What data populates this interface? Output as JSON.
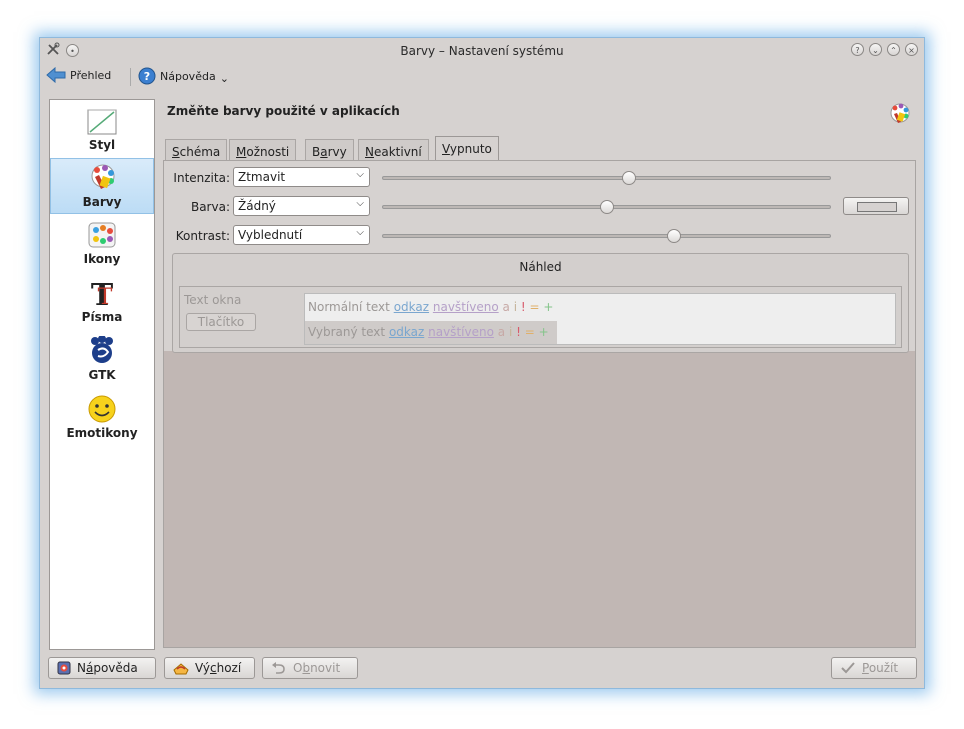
{
  "window": {
    "title": "Barvy – Nastavení systému"
  },
  "toolbar": {
    "back_label": "Přehled",
    "help_label": "Nápověda",
    "help_arrow": "⌄"
  },
  "sidebar": {
    "items": [
      {
        "label": "Styl",
        "icon": "style-icon"
      },
      {
        "label": "Barvy",
        "icon": "colors-icon"
      },
      {
        "label": "Ikony",
        "icon": "icons-icon"
      },
      {
        "label": "Písma",
        "icon": "fonts-icon"
      },
      {
        "label": "GTK",
        "icon": "gtk-icon"
      },
      {
        "label": "Emotikony",
        "icon": "emoticons-icon"
      }
    ],
    "active_index": 1
  },
  "main": {
    "heading": "Změňte barvy použité v aplikacích",
    "tabs": [
      {
        "label": "Schéma",
        "u": "S",
        "rest": "chéma"
      },
      {
        "label": "Možnosti",
        "u": "M",
        "rest": "ožnosti"
      },
      {
        "label": "Barvy",
        "pre": "B",
        "u": "a",
        "rest": "rvy"
      },
      {
        "label": "Neaktivní",
        "u": "N",
        "rest": "eaktivní"
      },
      {
        "label": "Vypnuto",
        "u": "V",
        "rest": "ypnuto"
      }
    ],
    "active_tab": 4,
    "rows": {
      "intensity": {
        "label": "Intenzita:",
        "value": "Ztmavit",
        "slider": 0.55
      },
      "color": {
        "label": "Barva:",
        "value": "Žádný",
        "slider": 0.5
      },
      "contrast": {
        "label": "Kontrast:",
        "value": "Vyblednutí",
        "slider": 0.65
      }
    },
    "preview": {
      "title": "Náhled",
      "window_text": "Text okna",
      "button": "Tlačítko",
      "normal_text": "Normální text",
      "selected_text": "Vybraný text",
      "link": "odkaz",
      "visited": "navštíveno",
      "a": "a",
      "i": "i",
      "excl": "!",
      "eq": "=",
      "plus": "+"
    }
  },
  "buttons": {
    "help": {
      "pre": "N",
      "u": "á",
      "rest": "pověda"
    },
    "defaults": {
      "pre": "Vý",
      "u": "c",
      "rest": "hozí"
    },
    "reset": {
      "pre": "O",
      "u": "b",
      "rest": "novit"
    },
    "apply": {
      "u": "P",
      "rest": "oužít"
    }
  }
}
